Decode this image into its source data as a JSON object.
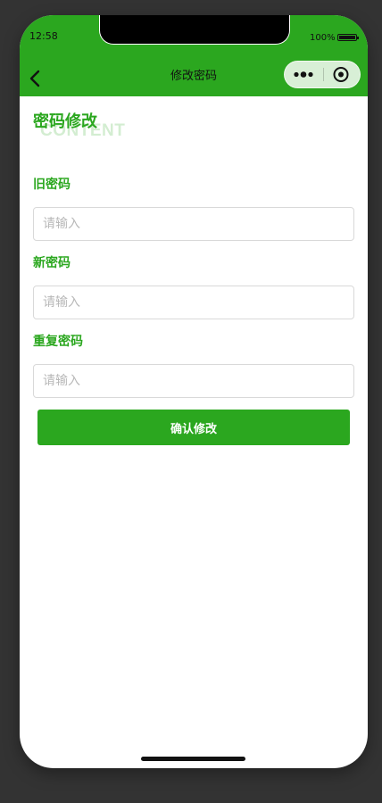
{
  "status_bar": {
    "time": "12:58",
    "battery": "100%"
  },
  "nav": {
    "title": "修改密码",
    "back_icon": "chevron-left-icon",
    "more_icon": "more-dots-icon",
    "close_icon": "target-circle-icon"
  },
  "form": {
    "section_title": "密码修改",
    "section_watermark": "CONTENT",
    "fields": [
      {
        "label": "旧密码",
        "placeholder": "请输入",
        "value": ""
      },
      {
        "label": "新密码",
        "placeholder": "请输入",
        "value": ""
      },
      {
        "label": "重复密码",
        "placeholder": "请输入",
        "value": ""
      }
    ],
    "submit_label": "确认修改"
  },
  "colors": {
    "brand": "#2ba71f",
    "frame_background": "#333333",
    "input_border": "#d9d9d9",
    "placeholder": "#b8b8b8"
  }
}
